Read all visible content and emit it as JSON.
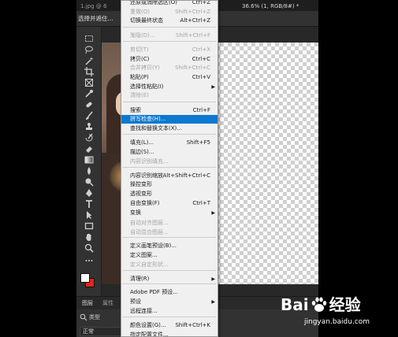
{
  "doc_tabs": [
    "1.jpg @ 6",
    "36.6% (1, RGB/8#) *"
  ],
  "options_bar": {
    "select_and_mask": "选择并遮住..."
  },
  "colors": {
    "foreground": "#ffffff",
    "background": "#e0261a",
    "menu_highlight": "#0b79d0"
  },
  "tools": [
    "marquee-icon",
    "lasso-icon",
    "magic-wand-icon",
    "crop-icon",
    "frame-icon",
    "eyedropper-icon",
    "healing-brush-icon",
    "brush-icon",
    "clone-stamp-icon",
    "history-brush-icon",
    "eraser-icon",
    "gradient-icon",
    "blur-icon",
    "dodge-icon",
    "pen-icon",
    "type-icon",
    "path-selection-icon",
    "rectangle-icon",
    "hand-icon",
    "zoom-icon",
    "more-tools-icon"
  ],
  "edit_menu": {
    "items": [
      {
        "label": "还原或消除选区(O)",
        "shortcut": "Ctrl+Z",
        "disabled": false
      },
      {
        "label": "重做(O)",
        "shortcut": "Shift+Ctrl+Z",
        "disabled": true
      },
      {
        "label": "切换最终状态",
        "shortcut": "Alt+Ctrl+Z",
        "disabled": false
      },
      {
        "label": "渐隐(D)...",
        "shortcut": "Shift+Ctrl+F",
        "disabled": true
      },
      {
        "label": "剪切(T)",
        "shortcut": "Ctrl+X",
        "disabled": true
      },
      {
        "label": "拷贝(C)",
        "shortcut": "Ctrl+C",
        "disabled": false
      },
      {
        "label": "合并拷贝(Y)",
        "shortcut": "Shift+Ctrl+C",
        "disabled": true
      },
      {
        "label": "粘贴(P)",
        "shortcut": "Ctrl+V",
        "disabled": false
      },
      {
        "label": "选择性粘贴(I)",
        "shortcut": "",
        "disabled": false,
        "submenu": true
      },
      {
        "label": "清除(E)",
        "shortcut": "",
        "disabled": true
      },
      {
        "label": "搜索",
        "shortcut": "Ctrl+F",
        "disabled": false
      },
      {
        "label": "拼写检查(H)...",
        "shortcut": "",
        "disabled": false,
        "highlighted": true
      },
      {
        "label": "查找和替换文本(X)...",
        "shortcut": "",
        "disabled": false
      },
      {
        "label": "填充(L)...",
        "shortcut": "Shift+F5",
        "disabled": false
      },
      {
        "label": "描边(S)...",
        "shortcut": "",
        "disabled": false
      },
      {
        "label": "内容识别填充...",
        "shortcut": "",
        "disabled": true
      },
      {
        "label": "内容识别缩放",
        "shortcut": "Alt+Shift+Ctrl+C",
        "disabled": false
      },
      {
        "label": "操控变形",
        "shortcut": "",
        "disabled": false
      },
      {
        "label": "透视变形",
        "shortcut": "",
        "disabled": false
      },
      {
        "label": "自由变换(F)",
        "shortcut": "Ctrl+T",
        "disabled": false
      },
      {
        "label": "变换",
        "shortcut": "",
        "disabled": false,
        "submenu": true
      },
      {
        "label": "自动对齐图层...",
        "shortcut": "",
        "disabled": true
      },
      {
        "label": "自动混合图层...",
        "shortcut": "",
        "disabled": true
      },
      {
        "label": "定义画笔预设(B)...",
        "shortcut": "",
        "disabled": false
      },
      {
        "label": "定义图案...",
        "shortcut": "",
        "disabled": false
      },
      {
        "label": "定义自定形状...",
        "shortcut": "",
        "disabled": true
      },
      {
        "label": "清理(R)",
        "shortcut": "",
        "disabled": false,
        "submenu": true
      },
      {
        "label": "Adobe PDF 预设...",
        "shortcut": "",
        "disabled": false
      },
      {
        "label": "预设",
        "shortcut": "",
        "disabled": false,
        "submenu": true
      },
      {
        "label": "远程连接...",
        "shortcut": "",
        "disabled": false
      },
      {
        "label": "颜色设置(G)...",
        "shortcut": "Shift+Ctrl+K",
        "disabled": false
      },
      {
        "label": "指定配置文件...",
        "shortcut": "",
        "disabled": false
      }
    ]
  },
  "layers_panel": {
    "tabs": [
      "图层",
      "属性"
    ],
    "filter_label": "类型",
    "blend_mode": "正常"
  },
  "watermark": {
    "logo_left": "Bai",
    "logo_right": "经验",
    "domain": "jingyan.baidu.com"
  }
}
